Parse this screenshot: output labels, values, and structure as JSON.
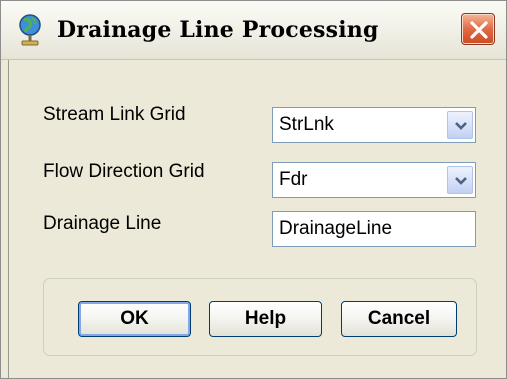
{
  "window": {
    "title": "Drainage Line Processing"
  },
  "fields": {
    "stream_link": {
      "label": "Stream Link Grid",
      "value": "StrLnk"
    },
    "flow_direction": {
      "label": "Flow Direction Grid",
      "value": "Fdr"
    },
    "drainage_line": {
      "label": "Drainage Line",
      "value": "DrainageLine"
    }
  },
  "buttons": {
    "ok": "OK",
    "help": "Help",
    "cancel": "Cancel"
  },
  "colors": {
    "dialog_background": "#ece9d8",
    "close_button": "#e06b45",
    "button_border": "#003c74"
  },
  "icons": {
    "title": "globe-pin-icon",
    "close": "close-icon",
    "dropdown": "chevron-down-icon"
  }
}
